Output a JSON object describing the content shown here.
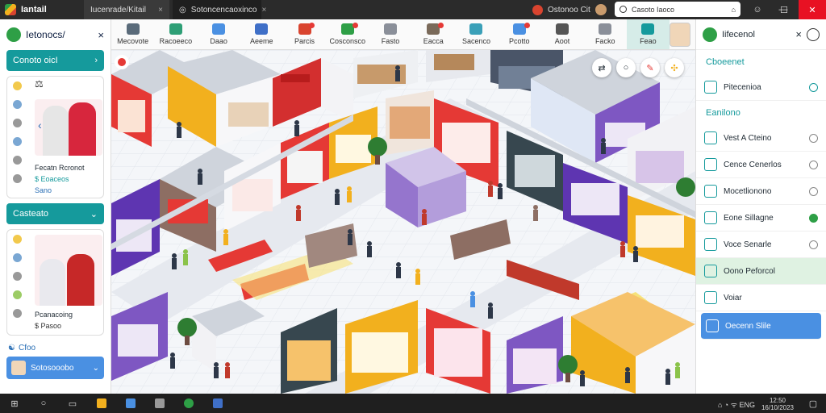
{
  "titlebar": {
    "app_name": "Iantail",
    "tabs": [
      {
        "label": "Iucenrade/Kitail",
        "close": "×"
      },
      {
        "label": "Sotoncencaoxinco",
        "close": "×"
      }
    ],
    "ext_label": "Ostonoo Cit",
    "search_text": "Casoto Iaoco",
    "win": {
      "min": "—",
      "max": "☐",
      "close": "✕"
    }
  },
  "toolbar": {
    "tools": [
      {
        "label": "Mecovote",
        "icon": "document-icon",
        "color": "#5a6b7a"
      },
      {
        "label": "Racoeeco",
        "icon": "cross-icon",
        "color": "#2e9f76"
      },
      {
        "label": "Daao",
        "icon": "box-icon",
        "color": "#4a90e2"
      },
      {
        "label": "Aeeme",
        "icon": "shield-icon",
        "color": "#3f6fc7"
      },
      {
        "label": "Parcis",
        "icon": "cart-icon",
        "color": "#d9442f",
        "badge": true
      },
      {
        "label": "Cosconsco",
        "icon": "chart-icon",
        "color": "#2e9f46",
        "badge": true
      },
      {
        "label": "Fasto",
        "icon": "shop-icon",
        "color": "#8a8f99"
      },
      {
        "label": "Eacca",
        "icon": "basket-icon",
        "color": "#7a6a5a",
        "badge": true
      },
      {
        "label": "Sacenco",
        "icon": "tag-icon",
        "color": "#3aa0b8"
      },
      {
        "label": "Pcotto",
        "icon": "ticket-icon",
        "color": "#4a90e2",
        "badge": true
      },
      {
        "label": "Aoot",
        "icon": "clock-icon",
        "color": "#555"
      },
      {
        "label": "Facko",
        "icon": "cube-icon",
        "color": "#8a8f99"
      },
      {
        "label": "Feao",
        "icon": "people-icon",
        "color": "#159a9c",
        "active": true
      }
    ]
  },
  "left_panel": {
    "title": "Ietonocs/",
    "close": "×",
    "section1": "Conoto oicI",
    "card1": {
      "name": "Fecatn Rcronot",
      "stat": "$ Eoaceos",
      "link": "Sano"
    },
    "section2": "Casteato",
    "card2": {
      "name": "Pcanacoing",
      "stat": "$ Pasoo"
    },
    "bottom_link": "Cfoo",
    "footer_btn": "Sotosooobo"
  },
  "map": {
    "controls": [
      "⇄",
      "○",
      "✎",
      "✣"
    ]
  },
  "right_panel": {
    "title": "Iifecenol",
    "section1": "Cboeenet",
    "section2": "Eanilono",
    "items": [
      {
        "label": "Pitecenioa",
        "radio": "on-outline",
        "group": 1
      },
      {
        "label": "Vest A Cteino",
        "radio": "off"
      },
      {
        "label": "Cence Cenerlos",
        "radio": "off"
      },
      {
        "label": "Mocetlionono",
        "radio": "off"
      },
      {
        "label": "Eone Sillagne",
        "radio": "on"
      },
      {
        "label": "Voce Senarle",
        "radio": "off"
      },
      {
        "label": "Oono Peforcol",
        "highlight": true
      },
      {
        "label": "Voiar"
      },
      {
        "label": "Oecenn Slile",
        "selected": true
      }
    ]
  },
  "taskbar": {
    "tray": "⌂ ◔ ᯤ ENG",
    "clock_time": "12:50",
    "clock_date": "16/10/2023"
  }
}
